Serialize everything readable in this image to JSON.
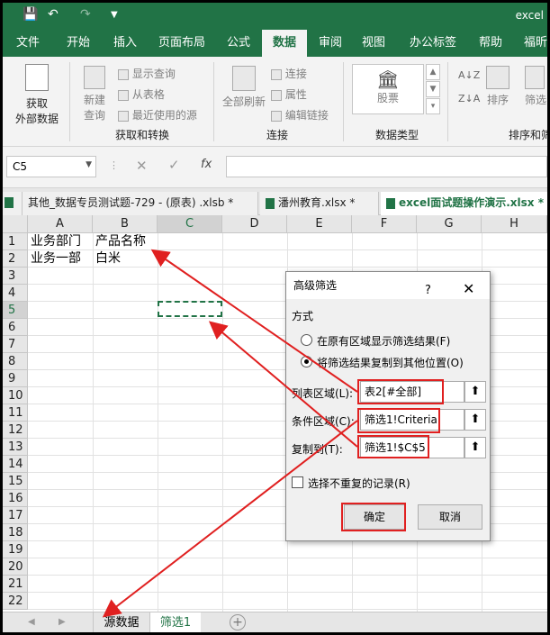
{
  "window": {
    "title": "excel"
  },
  "ribbon_tabs": [
    "文件",
    "开始",
    "插入",
    "页面布局",
    "公式",
    "数据",
    "审阅",
    "视图",
    "办公标签",
    "帮助",
    "福昕"
  ],
  "active_tab": "数据",
  "ribbon": {
    "get_data": "获取\n外部数据",
    "get_data_l1": "获取",
    "get_data_l2": "外部数据",
    "new_query_l1": "新建",
    "new_query_l2": "查询",
    "show_query": "显示查询",
    "from_table": "从表格",
    "recent_sources": "最近使用的源",
    "group_get_transform": "获取和转换",
    "refresh_all_l1": "全部刷新",
    "connections": "连接",
    "properties": "属性",
    "edit_links": "编辑链接",
    "group_connections": "连接",
    "stocks": "股票",
    "group_data_types": "数据类型",
    "sort": "排序",
    "filter": "筛选",
    "group_sort_filter": "排序和筛"
  },
  "formula_bar": {
    "name_box": "C5",
    "fx": "fx",
    "value": ""
  },
  "file_tabs": [
    {
      "label": "其他_数据专员测试题-729 -   (原表) .xlsb *",
      "active": false
    },
    {
      "label": "潘州教育.xlsx *",
      "active": false
    },
    {
      "label": "excel面试题操作演示.xlsx *",
      "active": true
    }
  ],
  "columns": [
    "A",
    "B",
    "C",
    "D",
    "E",
    "F",
    "G",
    "H"
  ],
  "rows": [
    "1",
    "2",
    "3",
    "4",
    "5",
    "6",
    "7",
    "8",
    "9",
    "10",
    "11",
    "12",
    "13",
    "14",
    "15",
    "16",
    "17",
    "18",
    "19",
    "20",
    "21",
    "22"
  ],
  "cells": {
    "A1": "业务部门",
    "B1": "产品名称",
    "A2": "业务一部",
    "B2": "白米"
  },
  "sheets": [
    {
      "label": "源数据",
      "active": false
    },
    {
      "label": "筛选1",
      "active": true
    }
  ],
  "dialog": {
    "title": "高级筛选",
    "help": "?",
    "close": "✕",
    "section": "方式",
    "option1": "在原有区域显示筛选结果(F)",
    "option2": "将筛选结果复制到其他位置(O)",
    "selected_option": 2,
    "list_range_label": "列表区域(L):",
    "list_range_value": "表2[#全部]",
    "criteria_label": "条件区域(C):",
    "criteria_value": "筛选1!Criteria",
    "copy_to_label": "复制到(T):",
    "copy_to_value": "筛选1!$C$5",
    "unique_label": "选择不重复的记录(R)",
    "unique_checked": false,
    "ok": "确定",
    "cancel": "取消"
  },
  "annotation_color": "#e02020"
}
